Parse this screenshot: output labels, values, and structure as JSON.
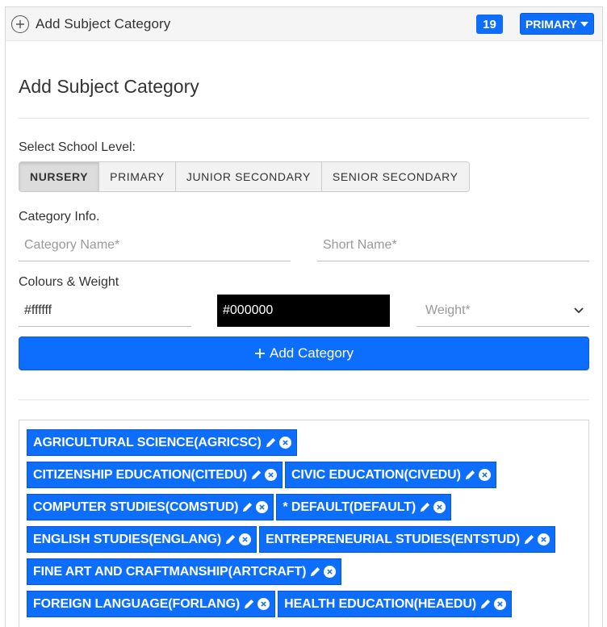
{
  "header": {
    "title": "Add Subject Category",
    "count": "19",
    "level_dropdown": "PRIMARY"
  },
  "form": {
    "title": "Add Subject Category",
    "school_level_label": "Select School Level:",
    "school_levels": [
      "NURSERY",
      "PRIMARY",
      "JUNIOR SECONDARY",
      "SENIOR SECONDARY"
    ],
    "selected_level": "NURSERY",
    "category_info_label": "Category Info.",
    "category_name_placeholder": "Category Name*",
    "short_name_placeholder": "Short Name*",
    "colours_label": "Colours & Weight",
    "background_colour": "#ffffff",
    "text_colour": "#000000",
    "weight_placeholder": "Weight*",
    "add_button_label": "Add Category"
  },
  "categories": [
    "AGRICULTURAL SCIENCE(AGRICSC)",
    "CITIZENSHIP EDUCATION(CITEDU)",
    "CIVIC EDUCATION(CIVEDU)",
    "COMPUTER STUDIES(COMSTUD)",
    "* DEFAULT(DEFAULT)",
    "ENGLISH STUDIES(ENGLANG)",
    "ENTREPRENEURIAL STUDIES(ENTSTUD)",
    "FINE ART AND CRAFTMANSHIP(ARTCRAFT)",
    "FOREIGN LANGUAGE(FORLANG)",
    "HEALTH EDUCATION(HEAEDU)"
  ],
  "colors": {
    "accent": "#0d6efd"
  }
}
